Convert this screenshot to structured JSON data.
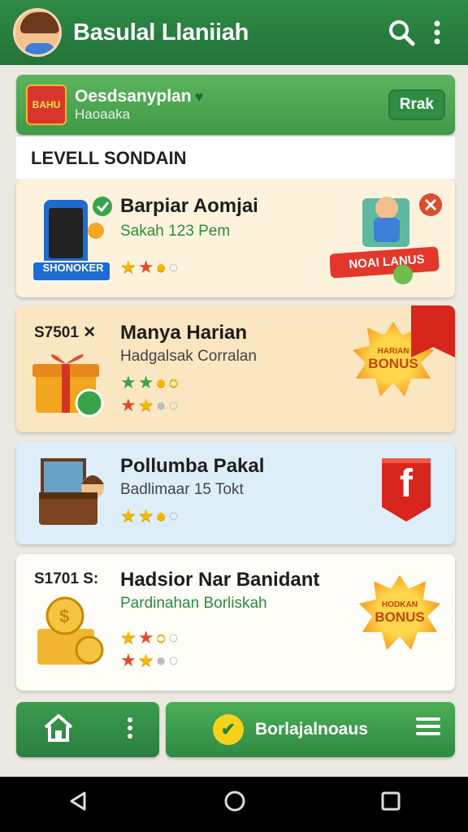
{
  "appbar": {
    "title": "Basulal Llaniiah",
    "search_icon": "search-icon",
    "more_icon": "more-vertical-icon"
  },
  "promo": {
    "badge": "BAHU",
    "title": "Oesdsanyplan",
    "subtitle": "Haoaaka",
    "button": "Rrak"
  },
  "section": {
    "title": "LEVELL SONDAIN"
  },
  "cards": [
    {
      "name": "Barpiar Aomjai",
      "sub": "Sakah 123 Pem",
      "ribbon": "SHONOKER",
      "banner": "NOAI LANUS",
      "stars": "★★○○",
      "bg": "#fdf3dc"
    },
    {
      "code": "S7501 ✕",
      "name": "Manya Harian",
      "sub": "Hadgalsak Corralan",
      "stars_a": "★★○○",
      "stars_b": "★★○○",
      "bonus_top": "HARIAN",
      "bonus_main": "BONUS",
      "bg": "#fbe6c2"
    },
    {
      "name": "Pollumba Pakal",
      "sub": "Badlimaar 15 Tokt",
      "stars": "★★○○",
      "fb": "f",
      "bg": "#ddeef8"
    },
    {
      "code": "S1701 S:",
      "name": "Hadsior Nar Banidant",
      "sub": "Pardinahan Borliskah",
      "stars_a": "★★○○",
      "stars_b": "★★○○",
      "bonus_top": "HODKAN",
      "bonus_main": "BONUS",
      "bg": "#fffdf8"
    }
  ],
  "bottom": {
    "home_icon": "home-icon",
    "label": "Borlajalnoaus"
  },
  "colors": {
    "primary": "#2f8a45",
    "accent": "#f5b700",
    "danger": "#e24a2c"
  }
}
